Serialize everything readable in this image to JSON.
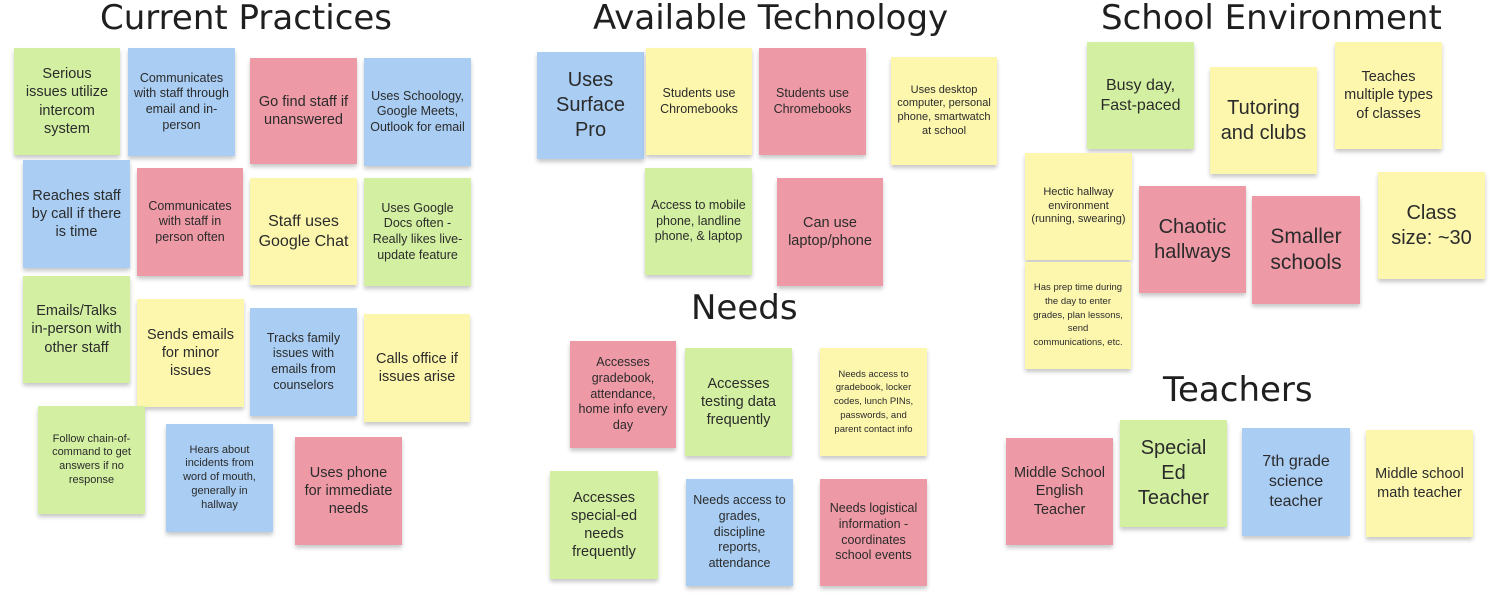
{
  "sections": {
    "current_practices": "Current Practices",
    "available_technology": "Available Technology",
    "school_environment": "School Environment",
    "needs": "Needs",
    "teachers": "Teachers"
  },
  "notes": {
    "cp1": "Serious issues utilize intercom system",
    "cp2": "Communicates with staff through email and in-person",
    "cp3": "Go find staff if unanswered",
    "cp4": "Uses Schoology, Google Meets, Outlook for email",
    "cp5": "Reaches staff by call if there is time",
    "cp6": "Communicates with staff in person often",
    "cp7": "Staff uses Google Chat",
    "cp8": "Uses Google Docs often - Really likes live-update feature",
    "cp9": "Emails/Talks in-person with other staff",
    "cp10": "Sends emails for minor issues",
    "cp11": "Tracks family issues with emails from counselors",
    "cp12": "Calls office if issues arise",
    "cp13": "Follow chain-of-command to get answers if no response",
    "cp14": "Hears about incidents from word of mouth, generally in hallway",
    "cp15": "Uses phone for immediate needs",
    "at1": "Uses Surface Pro",
    "at2": "Students use Chromebooks",
    "at3": "Students use Chromebooks",
    "at4": "Uses desktop computer, personal phone, smartwatch at school",
    "at5": "Access to mobile phone, landline phone, & laptop",
    "at6": "Can use laptop/phone",
    "nd1": "Accesses gradebook, attendance, home info every day",
    "nd2": "Accesses testing data frequently",
    "nd3": "Needs access to gradebook, locker codes, lunch PINs, passwords, and parent contact info",
    "nd4": "Accesses special-ed needs frequently",
    "nd5": "Needs access to grades, discipline reports, attendance",
    "nd6": "Needs logistical information - coordinates school events",
    "se1": "Busy day, Fast-paced",
    "se2": "Tutoring and clubs",
    "se3": "Teaches multiple types of classes",
    "se4": "Hectic hallway environment (running, swearing)",
    "se5": "Chaotic hallways",
    "se6": "Smaller schools",
    "se7": "Class size: ~30",
    "se8": "Has prep time during the day to enter grades, plan lessons, send communications, etc.",
    "t1": "Middle School English Teacher",
    "t2": "Special Ed Teacher",
    "t3": "7th grade science teacher",
    "t4": "Middle school math teacher"
  },
  "colors": {
    "green": "#d3f0a2",
    "blue": "#a9cdf3",
    "red": "#ee9aa6",
    "yellow": "#fdf7ae"
  }
}
